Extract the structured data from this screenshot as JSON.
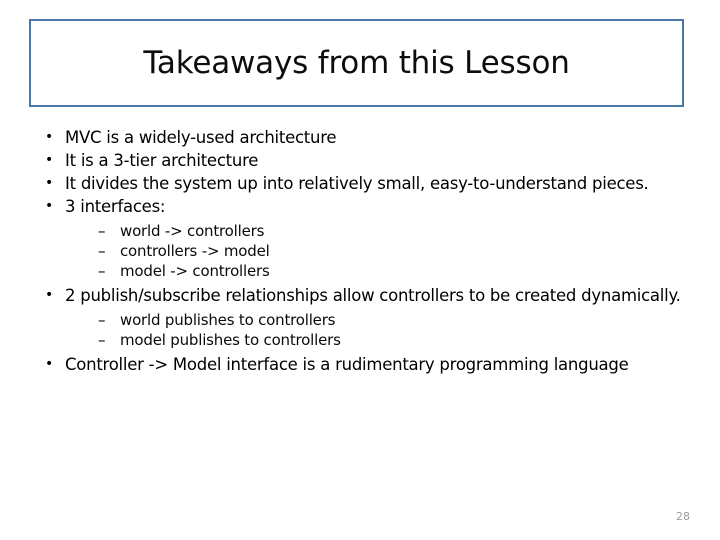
{
  "slide": {
    "background_color": "#ffffff",
    "title_border_color": "#4a77a8",
    "page_number_color": "#9a9a9a"
  },
  "title": {
    "text": "Takeaways from this Lesson"
  },
  "bullets": [
    {
      "text": "MVC is a widely-used architecture",
      "sub": []
    },
    {
      "text": "It is a 3-tier architecture",
      "sub": []
    },
    {
      "text": "It divides the system up into relatively small, easy-to-understand pieces.",
      "sub": []
    },
    {
      "text": "3 interfaces:",
      "sub": [
        "world -> controllers",
        "controllers -> model",
        "model -> controllers"
      ]
    },
    {
      "text": "2 publish/subscribe relationships allow controllers to be created dynamically.",
      "sub": [
        "world publishes to controllers",
        "model publishes to controllers"
      ]
    },
    {
      "text": "Controller -> Model interface is a rudimentary programming language",
      "sub": []
    }
  ],
  "footer": {
    "page_number": "28"
  }
}
